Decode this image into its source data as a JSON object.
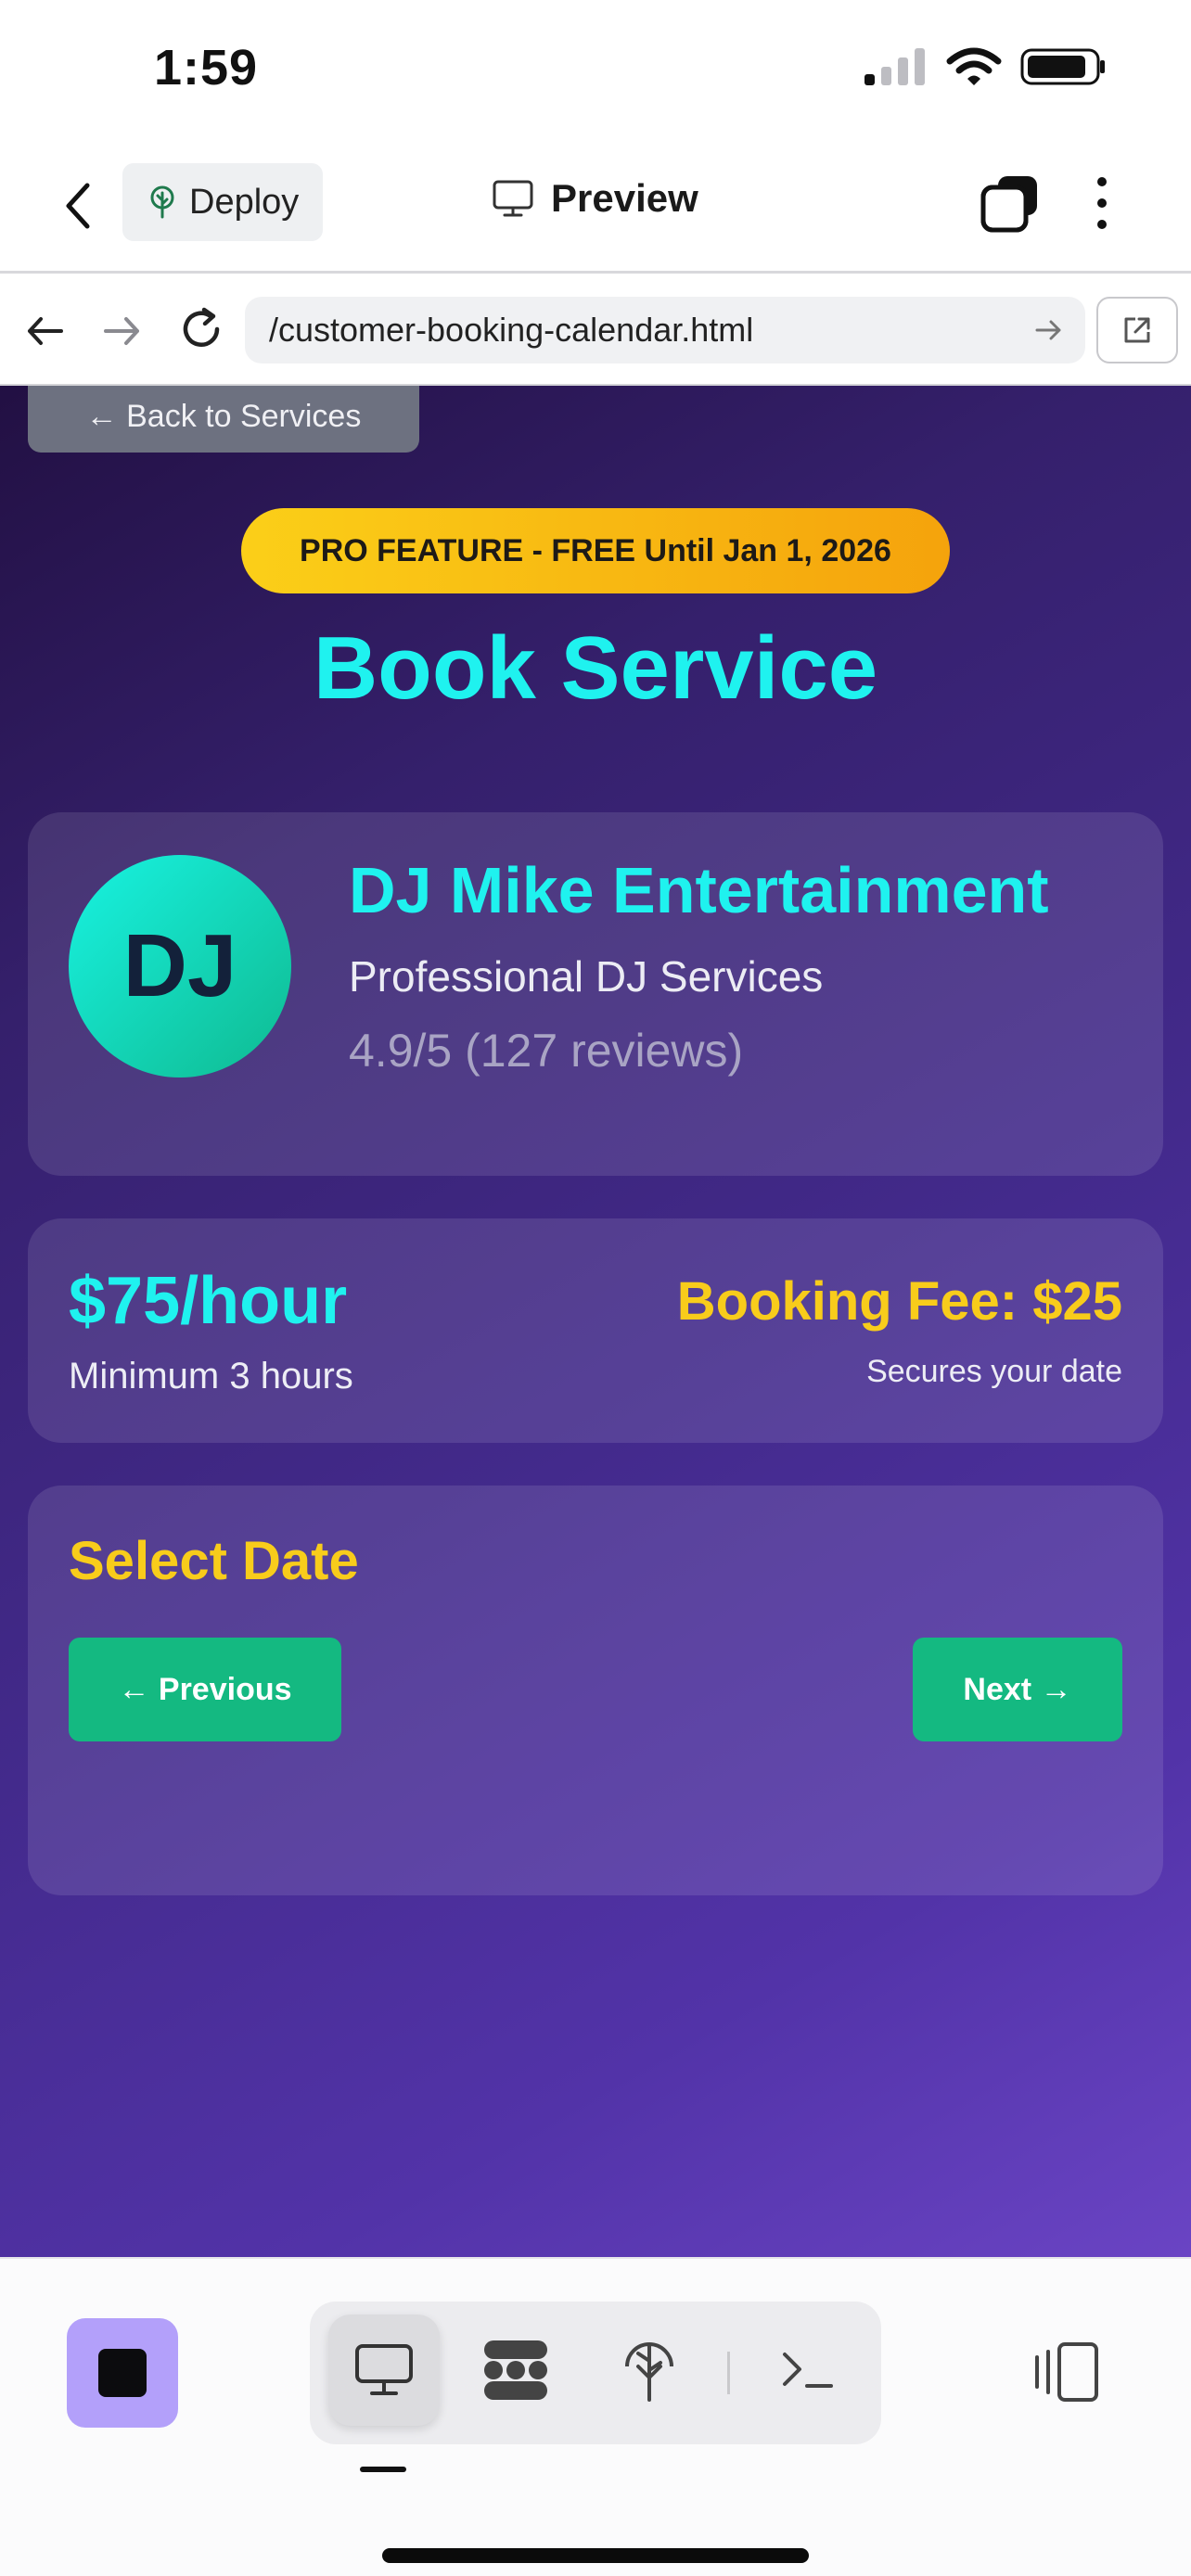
{
  "status_bar": {
    "time": "1:59"
  },
  "header": {
    "deploy_label": "Deploy",
    "preview_label": "Preview"
  },
  "browser": {
    "url": "/customer-booking-calendar.html"
  },
  "page": {
    "back_label": "← Back to Services",
    "pro_badge": "PRO FEATURE - FREE Until Jan 1, 2026",
    "title": "Book Service"
  },
  "provider": {
    "avatar_initials": "DJ",
    "name": "DJ Mike Entertainment",
    "description": "Professional DJ Services",
    "rating": "4.9/5 (127 reviews)"
  },
  "pricing": {
    "rate": "$75/hour",
    "minimum": "Minimum 3 hours",
    "booking_fee": "Booking Fee: $25",
    "fee_note": "Secures your date"
  },
  "date_select": {
    "title": "Select Date",
    "previous_label": "← Previous",
    "next_label": "Next →"
  },
  "colors": {
    "accent_cyan": "#1ff2ef",
    "accent_yellow": "#f8cc1b",
    "button_green": "#14b981",
    "stop_button": "#b3a0fa"
  },
  "icons": {
    "toolbar": [
      "monitor-icon",
      "dots-grid-icon",
      "deploy-tree-icon",
      "terminal-icon"
    ]
  }
}
